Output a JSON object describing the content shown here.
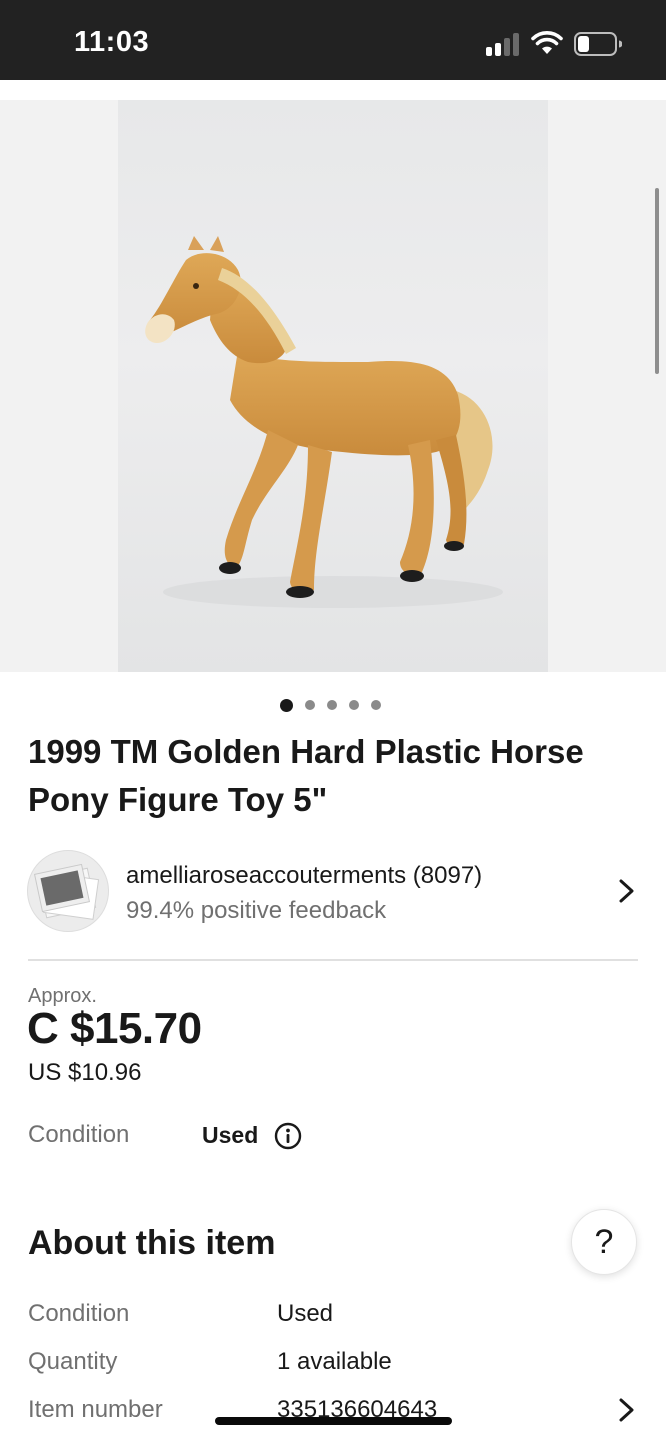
{
  "status_bar": {
    "time": "11:03",
    "icons": [
      "cellular-signal-icon",
      "wifi-icon",
      "battery-icon"
    ],
    "battery_level": 0.25
  },
  "gallery": {
    "image_count": 5,
    "active_index": 0
  },
  "listing": {
    "title": "1999 TM Golden Hard Plastic Horse Pony Figure Toy 5\""
  },
  "seller": {
    "name_with_score": "amelliaroseaccouterments (8097)",
    "feedback": "99.4% positive feedback"
  },
  "price": {
    "approx_label": "Approx.",
    "converted": "C $15.70",
    "original": "US $10.96"
  },
  "condition": {
    "label": "Condition",
    "value": "Used"
  },
  "about": {
    "title": "About this item",
    "help_label": "?",
    "rows": [
      {
        "label": "Condition",
        "value": "Used"
      },
      {
        "label": "Quantity",
        "value": "1 available"
      },
      {
        "label": "Item number",
        "value": "335136604643"
      }
    ]
  },
  "colors": {
    "status_bar_bg": "#222222",
    "text_primary": "#191919",
    "text_secondary": "#707070",
    "divider": "#e0e0e0"
  }
}
